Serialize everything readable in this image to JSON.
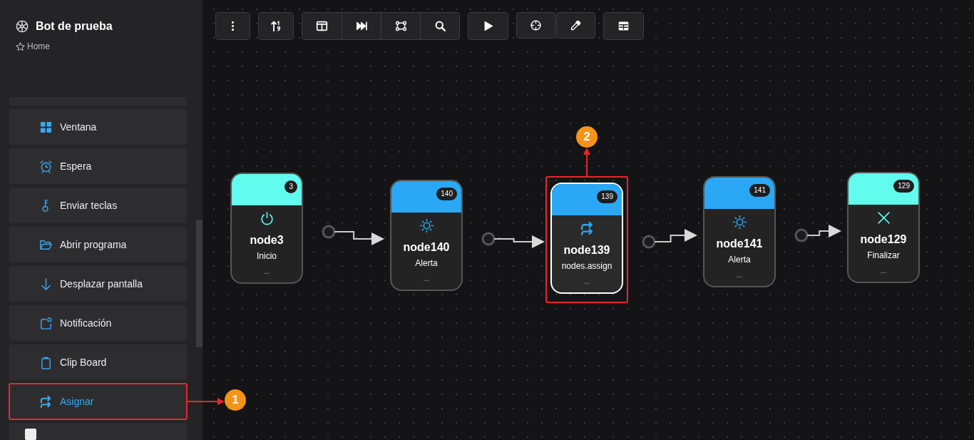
{
  "sidebar": {
    "title": "Bot de prueba",
    "breadcrumb": "Home",
    "items": [
      {
        "label": "Ventana",
        "kind": "window",
        "selected": false
      },
      {
        "label": "Espera",
        "kind": "alarm",
        "selected": false
      },
      {
        "label": "Enviar teclas",
        "kind": "key",
        "selected": false
      },
      {
        "label": "Abrir programa",
        "kind": "folder",
        "selected": false
      },
      {
        "label": "Desplazar pantalla",
        "kind": "scroll",
        "selected": false
      },
      {
        "label": "Notificación",
        "kind": "notify",
        "selected": false
      },
      {
        "label": "Clip Board",
        "kind": "clipboard",
        "selected": false
      },
      {
        "label": "Asignar",
        "kind": "assign",
        "selected": true,
        "callout": "1"
      }
    ]
  },
  "nodes": [
    {
      "badge": "3",
      "name": "node3",
      "subtitle": "Inicio",
      "more": "...",
      "kind": "start",
      "color": "#62fcee",
      "selected": false
    },
    {
      "badge": "140",
      "name": "node140",
      "subtitle": "Alerta",
      "more": "...",
      "kind": "alert",
      "color": "#2aa8f6",
      "selected": false
    },
    {
      "badge": "139",
      "name": "node139",
      "subtitle": "nodes.assign",
      "more": "...",
      "kind": "assign",
      "color": "#2aa8f6",
      "selected": true,
      "callout": "2"
    },
    {
      "badge": "141",
      "name": "node141",
      "subtitle": "Alerta",
      "more": "...",
      "kind": "alert",
      "color": "#2aa8f6",
      "selected": false
    },
    {
      "badge": "129",
      "name": "node129",
      "subtitle": "Finalizar",
      "more": "...",
      "kind": "end",
      "color": "#62fcee",
      "selected": false
    }
  ]
}
